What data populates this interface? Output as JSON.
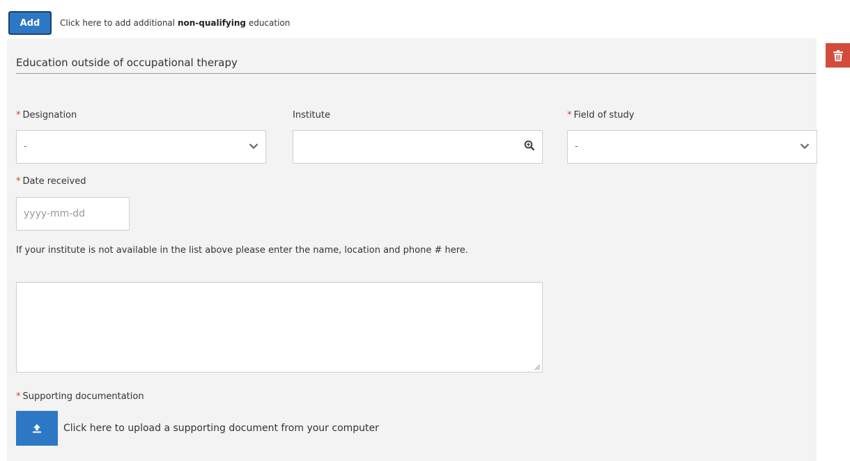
{
  "add_bar": {
    "add_label": "Add",
    "text_pre": "Click here to add additional ",
    "text_bold": "non-qualifying",
    "text_post": " education"
  },
  "section": {
    "title": "Education outside of occupational therapy"
  },
  "fields": {
    "required_mark": "*",
    "designation": {
      "label": "Designation",
      "value": "-"
    },
    "institute": {
      "label": "Institute",
      "value": ""
    },
    "field_of_study": {
      "label": "Field of study",
      "value": "-"
    },
    "date_received": {
      "label": "Date received",
      "placeholder": "yyyy-mm-dd"
    },
    "other_institute_help": "If your institute is not available in the list above please enter the name, location and phone # here.",
    "supporting_documentation": {
      "label": "Supporting documentation"
    }
  },
  "upload": {
    "text": "Click here to upload a supporting document from your computer"
  },
  "icons": {
    "delete": "trash-icon",
    "upload": "upload-icon",
    "search": "magnify-plus-icon",
    "dropdown": "chevron-down-icon"
  },
  "colors": {
    "primary": "#2c78c4",
    "danger": "#d24b3b",
    "required": "#d93a2b",
    "panel_bg": "#f3f3f3"
  }
}
